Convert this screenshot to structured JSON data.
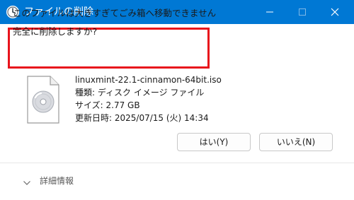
{
  "window": {
    "title": "ファイルの削除",
    "title_icon": "clock-icon",
    "controls": {
      "minimize": "minimize-icon",
      "maximize": "maximize-icon",
      "close": "close-icon"
    }
  },
  "message": {
    "line1": "このファイルは大きすぎてごみ箱へ移動できません",
    "line2": "完全に削除しますか?"
  },
  "file": {
    "icon": "disc-image-icon",
    "name": "linuxmint-22.1-cinnamon-64bit.iso",
    "type": "種類: ディスク イメージ ファイル",
    "size": "サイズ: 2.77 GB",
    "modified": "更新日時: 2025/07/15 (火) 14:34"
  },
  "buttons": {
    "yes": "はい(Y)",
    "no": "いいえ(N)"
  },
  "details": {
    "label": "詳細情報",
    "icon": "chevron-down-icon"
  },
  "colors": {
    "titlebar": "#0078d4",
    "highlight_border": "#e8141c"
  }
}
